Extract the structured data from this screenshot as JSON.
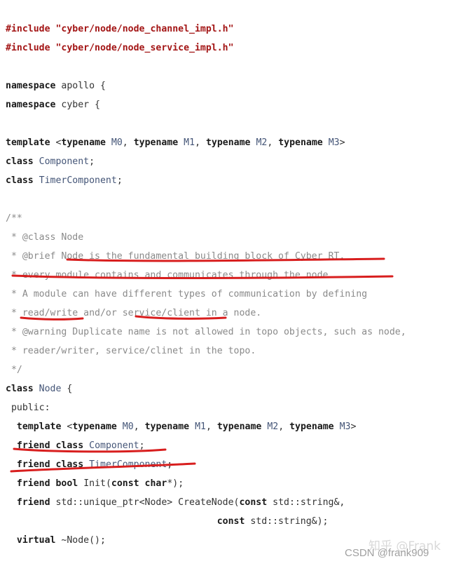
{
  "lines": [
    {
      "tokens": [
        {
          "t": "#include ",
          "c": "pp"
        },
        {
          "t": "\"cyber/node/node_channel_impl.h\"",
          "c": "str"
        }
      ]
    },
    {
      "tokens": [
        {
          "t": "#include ",
          "c": "pp"
        },
        {
          "t": "\"cyber/node/node_service_impl.h\"",
          "c": "str"
        }
      ]
    },
    {
      "tokens": []
    },
    {
      "tokens": [
        {
          "t": "namespace",
          "c": "kw"
        },
        {
          "t": " apollo {",
          "c": ""
        }
      ]
    },
    {
      "tokens": [
        {
          "t": "namespace",
          "c": "kw"
        },
        {
          "t": " cyber {",
          "c": ""
        }
      ]
    },
    {
      "tokens": []
    },
    {
      "tokens": [
        {
          "t": "template",
          "c": "kw"
        },
        {
          "t": " <",
          "c": ""
        },
        {
          "t": "typename",
          "c": "kw"
        },
        {
          "t": " ",
          "c": ""
        },
        {
          "t": "M0",
          "c": "tparam"
        },
        {
          "t": ", ",
          "c": ""
        },
        {
          "t": "typename",
          "c": "kw"
        },
        {
          "t": " ",
          "c": ""
        },
        {
          "t": "M1",
          "c": "tparam"
        },
        {
          "t": ", ",
          "c": ""
        },
        {
          "t": "typename",
          "c": "kw"
        },
        {
          "t": " ",
          "c": ""
        },
        {
          "t": "M2",
          "c": "tparam"
        },
        {
          "t": ", ",
          "c": ""
        },
        {
          "t": "typename",
          "c": "kw"
        },
        {
          "t": " ",
          "c": ""
        },
        {
          "t": "M3",
          "c": "tparam"
        },
        {
          "t": ">",
          "c": ""
        }
      ]
    },
    {
      "tokens": [
        {
          "t": "class",
          "c": "kw"
        },
        {
          "t": " ",
          "c": ""
        },
        {
          "t": "Component",
          "c": "type"
        },
        {
          "t": ";",
          "c": ""
        }
      ]
    },
    {
      "tokens": [
        {
          "t": "class",
          "c": "kw"
        },
        {
          "t": " ",
          "c": ""
        },
        {
          "t": "TimerComponent",
          "c": "type"
        },
        {
          "t": ";",
          "c": ""
        }
      ]
    },
    {
      "tokens": []
    },
    {
      "tokens": [
        {
          "t": "/**",
          "c": "cm"
        }
      ]
    },
    {
      "tokens": [
        {
          "t": " * @class Node",
          "c": "cm"
        }
      ]
    },
    {
      "tokens": [
        {
          "t": " * @brief Node is the fundamental building block of Cyber RT.",
          "c": "cm"
        }
      ]
    },
    {
      "tokens": [
        {
          "t": " * every module contains and communicates through the node.",
          "c": "cm"
        }
      ]
    },
    {
      "tokens": [
        {
          "t": " * A module can have different types of communication by defining",
          "c": "cm"
        }
      ]
    },
    {
      "tokens": [
        {
          "t": " * read/write and/or service/client in a node.",
          "c": "cm"
        }
      ]
    },
    {
      "tokens": [
        {
          "t": " * @warning Duplicate name is not allowed in topo objects, such as node,",
          "c": "cm"
        }
      ]
    },
    {
      "tokens": [
        {
          "t": " * reader/writer, service/clinet in the topo.",
          "c": "cm"
        }
      ]
    },
    {
      "tokens": [
        {
          "t": " */",
          "c": "cm"
        }
      ]
    },
    {
      "tokens": [
        {
          "t": "class",
          "c": "kw"
        },
        {
          "t": " ",
          "c": ""
        },
        {
          "t": "Node",
          "c": "type"
        },
        {
          "t": " {",
          "c": ""
        }
      ]
    },
    {
      "tokens": [
        {
          "t": " public:",
          "c": ""
        }
      ]
    },
    {
      "tokens": [
        {
          "t": "  ",
          "c": ""
        },
        {
          "t": "template",
          "c": "kw"
        },
        {
          "t": " <",
          "c": ""
        },
        {
          "t": "typename",
          "c": "kw"
        },
        {
          "t": " ",
          "c": ""
        },
        {
          "t": "M0",
          "c": "tparam"
        },
        {
          "t": ", ",
          "c": ""
        },
        {
          "t": "typename",
          "c": "kw"
        },
        {
          "t": " ",
          "c": ""
        },
        {
          "t": "M1",
          "c": "tparam"
        },
        {
          "t": ", ",
          "c": ""
        },
        {
          "t": "typename",
          "c": "kw"
        },
        {
          "t": " ",
          "c": ""
        },
        {
          "t": "M2",
          "c": "tparam"
        },
        {
          "t": ", ",
          "c": ""
        },
        {
          "t": "typename",
          "c": "kw"
        },
        {
          "t": " ",
          "c": ""
        },
        {
          "t": "M3",
          "c": "tparam"
        },
        {
          "t": ">",
          "c": ""
        }
      ]
    },
    {
      "tokens": [
        {
          "t": "  ",
          "c": ""
        },
        {
          "t": "friend",
          "c": "kw"
        },
        {
          "t": " ",
          "c": ""
        },
        {
          "t": "class",
          "c": "kw"
        },
        {
          "t": " ",
          "c": ""
        },
        {
          "t": "Component",
          "c": "type"
        },
        {
          "t": ";",
          "c": ""
        }
      ]
    },
    {
      "tokens": [
        {
          "t": "  ",
          "c": ""
        },
        {
          "t": "friend",
          "c": "kw"
        },
        {
          "t": " ",
          "c": ""
        },
        {
          "t": "class",
          "c": "kw"
        },
        {
          "t": " ",
          "c": ""
        },
        {
          "t": "TimerComponent",
          "c": "type"
        },
        {
          "t": ";",
          "c": ""
        }
      ]
    },
    {
      "tokens": [
        {
          "t": "  ",
          "c": ""
        },
        {
          "t": "friend",
          "c": "kw"
        },
        {
          "t": " ",
          "c": ""
        },
        {
          "t": "bool",
          "c": "kw"
        },
        {
          "t": " Init(",
          "c": ""
        },
        {
          "t": "const",
          "c": "kw"
        },
        {
          "t": " ",
          "c": ""
        },
        {
          "t": "char",
          "c": "kw"
        },
        {
          "t": "*);",
          "c": ""
        }
      ]
    },
    {
      "tokens": [
        {
          "t": "  ",
          "c": ""
        },
        {
          "t": "friend",
          "c": "kw"
        },
        {
          "t": " std::unique_ptr<Node> CreateNode(",
          "c": ""
        },
        {
          "t": "const",
          "c": "kw"
        },
        {
          "t": " std::string&,",
          "c": ""
        }
      ]
    },
    {
      "tokens": [
        {
          "t": "                                      ",
          "c": ""
        },
        {
          "t": "const",
          "c": "kw"
        },
        {
          "t": " std::string&);",
          "c": ""
        }
      ]
    },
    {
      "tokens": [
        {
          "t": "  ",
          "c": ""
        },
        {
          "t": "virtual",
          "c": "kw"
        },
        {
          "t": " ~Node();",
          "c": ""
        }
      ]
    }
  ],
  "watermark": {
    "zhihu": "知乎 @Frank",
    "csdn": "CSDN @frank909"
  },
  "colors": {
    "keyword": "#1a1a1a",
    "preprocessor": "#a31515",
    "type": "#445577",
    "comment": "#8a8a8a",
    "annotation": "#d81e1e"
  }
}
